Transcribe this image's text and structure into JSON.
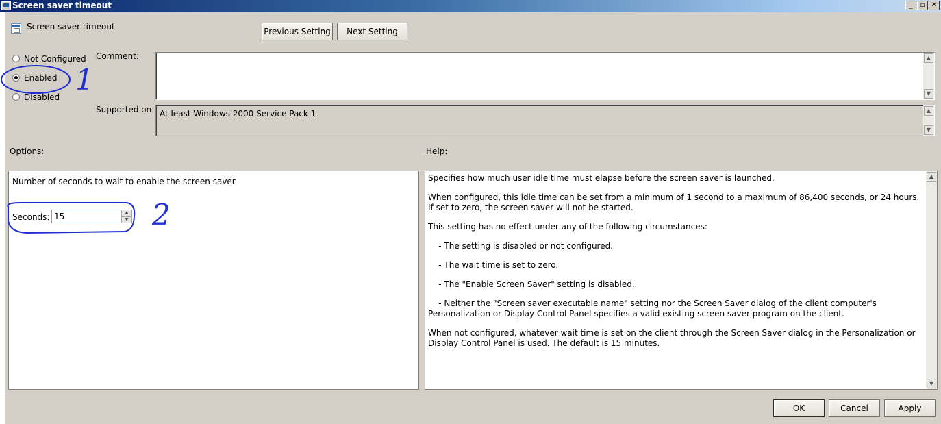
{
  "window": {
    "title": "Screen saver timeout",
    "controls": {
      "minimize": "_",
      "restore": "▫",
      "close": "✕"
    }
  },
  "policy": {
    "name": "Screen saver timeout"
  },
  "nav": {
    "previous_label": "Previous Setting",
    "next_label": "Next Setting"
  },
  "state": {
    "options": [
      {
        "label": "Not Configured",
        "checked": false
      },
      {
        "label": "Enabled",
        "checked": true
      },
      {
        "label": "Disabled",
        "checked": false
      }
    ]
  },
  "comment": {
    "label": "Comment:",
    "value": ""
  },
  "supported": {
    "label": "Supported on:",
    "value": "At least Windows 2000 Service Pack 1"
  },
  "options_section": {
    "label": "Options:",
    "description": "Number of seconds to wait to enable the screen saver",
    "seconds_label": "Seconds:",
    "seconds_value": "15"
  },
  "help": {
    "label": "Help:",
    "paragraphs": [
      "Specifies how much user idle time must elapse before the screen saver is launched.",
      "When configured, this idle time can be set from a minimum of 1 second to a maximum of 86,400 seconds, or 24 hours. If set to zero, the screen saver will not be started.",
      "This setting has no effect under any of the following circumstances:",
      "    - The setting is disabled or not configured.",
      "    - The wait time is set to zero.",
      "    - The \"Enable Screen Saver\" setting is disabled.",
      "    - Neither the \"Screen saver executable name\" setting nor the Screen Saver dialog of the client computer's Personalization or Display Control Panel specifies a valid existing screen saver program on the client.",
      "When not configured, whatever wait time is set on the client through the Screen Saver dialog in the Personalization or Display Control Panel is used. The default is 15 minutes."
    ]
  },
  "footer": {
    "ok_label": "OK",
    "cancel_label": "Cancel",
    "apply_label": "Apply"
  },
  "annotations": {
    "mark_1": "1",
    "mark_2": "2",
    "ink_color": "#1f2fd1"
  }
}
